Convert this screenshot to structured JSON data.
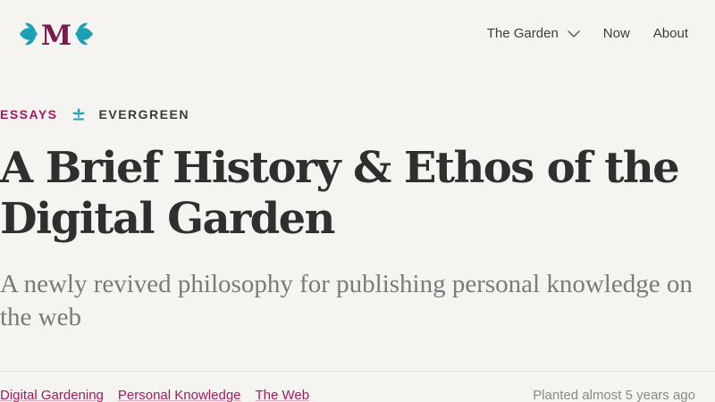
{
  "brand": {
    "logo_letter": "M",
    "logo_color": "#7a1a4a",
    "leaf_color": "#1ba0b5",
    "icon": "leaf-logo-icon"
  },
  "nav": {
    "items": [
      {
        "label": "The Garden",
        "has_dropdown": true
      },
      {
        "label": "Now"
      },
      {
        "label": "About"
      }
    ],
    "dropdown_icon": "chevron-down-icon"
  },
  "kicker": {
    "category": "ESSAYS",
    "stage_icon": "evergreen-tree-icon",
    "stage": "EVERGREEN",
    "accent_color": "#a3195b",
    "icon_color": "#1ba0b5"
  },
  "article": {
    "title": "A Brief History & Ethos of the Digital Garden",
    "subtitle": "A newly revived philosophy for publishing personal knowledge on the web"
  },
  "meta": {
    "tags": [
      "Digital Gardening",
      "Personal Knowledge",
      "The Web"
    ],
    "planted": "Planted almost 5 years ago"
  }
}
